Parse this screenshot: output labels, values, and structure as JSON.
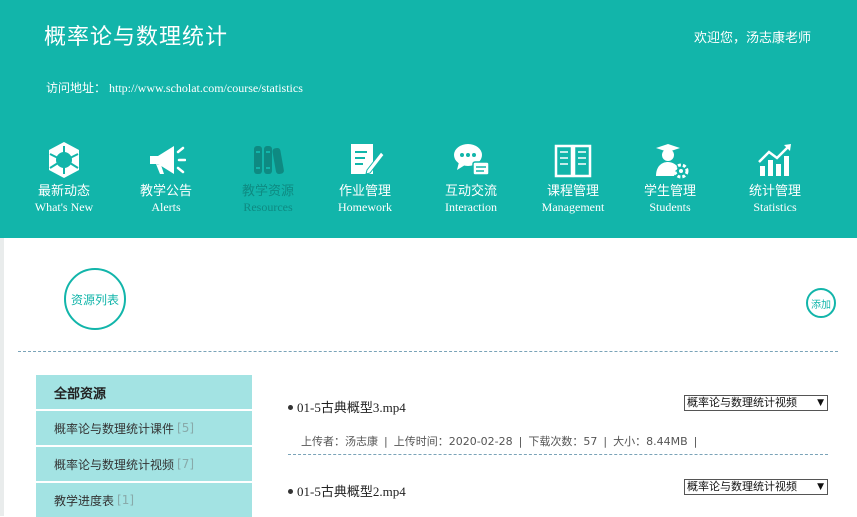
{
  "header": {
    "course_title": "概率论与数理统计",
    "welcome": "欢迎您，汤志康老师",
    "visit_label": "访问地址：",
    "visit_url": "http://www.scholat.com/course/statistics"
  },
  "nav": [
    {
      "zh": "最新动态",
      "en": "What's New",
      "icon": "news-icon"
    },
    {
      "zh": "教学公告",
      "en": "Alerts",
      "icon": "megaphone-icon"
    },
    {
      "zh": "教学资源",
      "en": "Resources",
      "icon": "books-icon",
      "active": true
    },
    {
      "zh": "作业管理",
      "en": "Homework",
      "icon": "homework-icon"
    },
    {
      "zh": "互动交流",
      "en": "Interaction",
      "icon": "chat-icon"
    },
    {
      "zh": "课程管理",
      "en": "Management",
      "icon": "open-book-icon"
    },
    {
      "zh": "学生管理",
      "en": "Students",
      "icon": "student-gear-icon"
    },
    {
      "zh": "统计管理",
      "en": "Statistics",
      "icon": "chart-icon"
    }
  ],
  "section": {
    "title": "资源列表",
    "add_label": "添加"
  },
  "sidebar": {
    "head": "全部资源",
    "items": [
      {
        "label": "概率论与数理统计课件",
        "count": "[5]"
      },
      {
        "label": "概率论与数理统计视频",
        "count": "[7]"
      },
      {
        "label": "教学进度表",
        "count": "[1]"
      }
    ]
  },
  "files": [
    {
      "name": "01-5古典概型3.mp4",
      "category": "概率论与数理统计视频",
      "uploader": "上传者：汤志康",
      "upload_time": "上传时间：2020-02-28",
      "downloads": "下载次数：57",
      "size": "大小：8.44MB"
    },
    {
      "name": "01-5古典概型2.mp4",
      "category": "概率论与数理统计视频"
    }
  ],
  "colors": {
    "teal": "#12b5aa",
    "sidebar_bg": "#a3e3e3",
    "dim_text": "#0e8a82"
  }
}
